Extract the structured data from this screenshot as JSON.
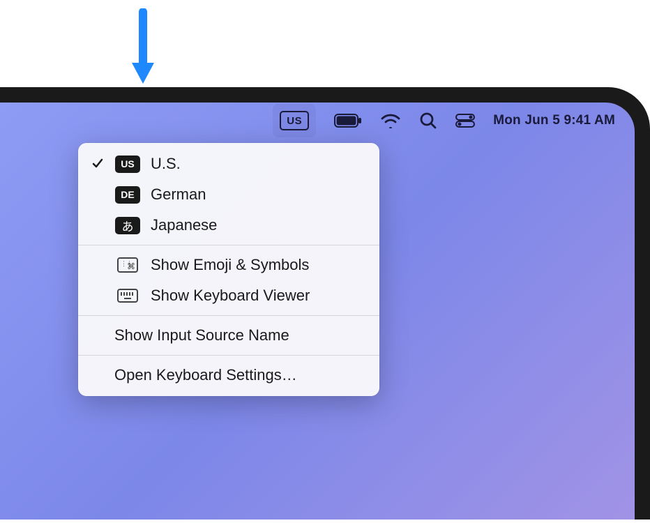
{
  "annotation": {
    "arrow_color": "#1e88ff"
  },
  "menubar": {
    "input_source_badge": "US",
    "clock": "Mon Jun 5  9:41 AM"
  },
  "input_menu": {
    "sources": [
      {
        "badge": "US",
        "label": "U.S.",
        "selected": true
      },
      {
        "badge": "DE",
        "label": "German",
        "selected": false
      },
      {
        "badge": "あ",
        "label": "Japanese",
        "selected": false
      }
    ],
    "show_emoji": "Show Emoji & Symbols",
    "show_keyboard_viewer": "Show Keyboard Viewer",
    "show_input_source_name": "Show Input Source Name",
    "open_keyboard_settings": "Open Keyboard Settings…"
  }
}
